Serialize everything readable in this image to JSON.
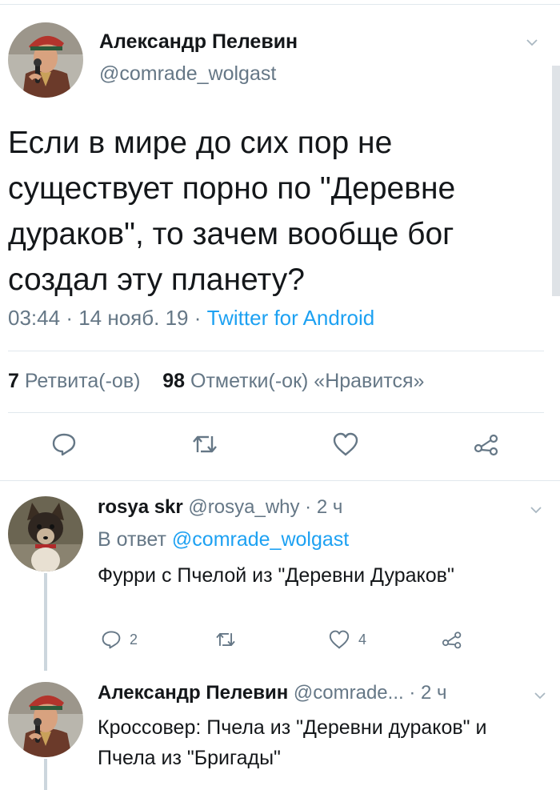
{
  "tweet": {
    "author_name": "Александр Пелевин",
    "author_handle": "@comrade_wolgast",
    "text": "Если в мире до сих пор не\nсуществует порно по \"Деревне\nдураков\", то зачем вообще бог\nсоздал эту планету?",
    "time": "03:44",
    "date": "14 нояб. 19",
    "separator": "·",
    "source": "Twitter for Android",
    "retweets_count": "7",
    "retweets_label": "Ретвита(-ов)",
    "likes_count": "98",
    "likes_label": "Отметки(-ок) «Нравится»"
  },
  "reply": {
    "author_name": "rosya skr",
    "author_handle": "@rosya_why",
    "age": "· 2 ч",
    "reply_prefix": "В ответ",
    "reply_mention": "@comrade_wolgast",
    "text": "Фурри с Пчелой из \"Деревни Дураков\"",
    "reply_count": "2",
    "like_count": "4"
  },
  "reply2": {
    "author_name": "Александр Пелевин",
    "author_handle": "@comrade...",
    "age": "· 2 ч",
    "text": "Кроссовер: Пчела из \"Деревни дураков\" и Пчела из \"Бригады\""
  },
  "icons": {
    "reply": "reply-icon",
    "retweet": "retweet-icon",
    "like": "heart-icon",
    "share": "share-icon",
    "caret": "chevron-down-icon"
  },
  "colors": {
    "accent": "#1da1f2",
    "muted": "#657786",
    "text": "#14171a",
    "divider": "#e1e8ed"
  }
}
